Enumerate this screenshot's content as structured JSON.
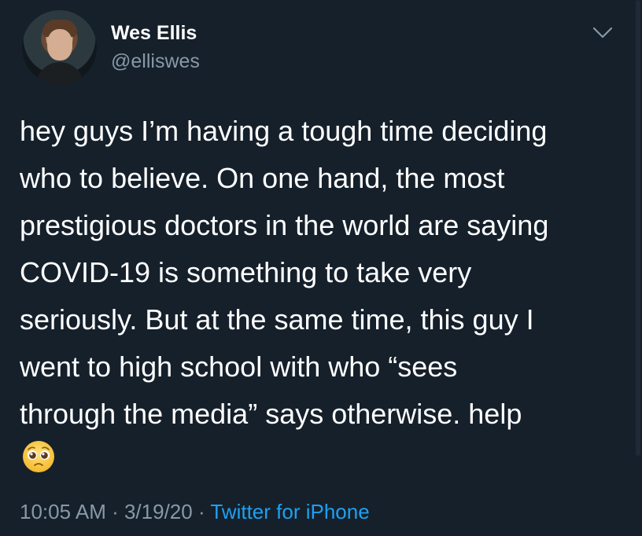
{
  "author": {
    "name": "Wes Ellis",
    "handle": "@elliswes"
  },
  "tweet": {
    "lines": [
      "hey guys I’m having a tough time deciding",
      "who to believe. On one hand, the most",
      "prestigious doctors in the world are saying",
      "COVID-19 is something to take very",
      "seriously. But at the same time, this guy I",
      "went to high school with who “sees",
      "through the media” says otherwise. help"
    ],
    "emoji": "pleading-face-emoji"
  },
  "meta": {
    "time": "10:05 AM",
    "separator1": " · ",
    "date": "3/19/20",
    "separator2": " · ",
    "source": "Twitter for iPhone"
  },
  "icons": {
    "menu": "chevron-down-icon"
  },
  "colors": {
    "background": "#15202b",
    "text": "#ffffff",
    "secondary": "#8899a6",
    "link": "#1da1f2"
  }
}
